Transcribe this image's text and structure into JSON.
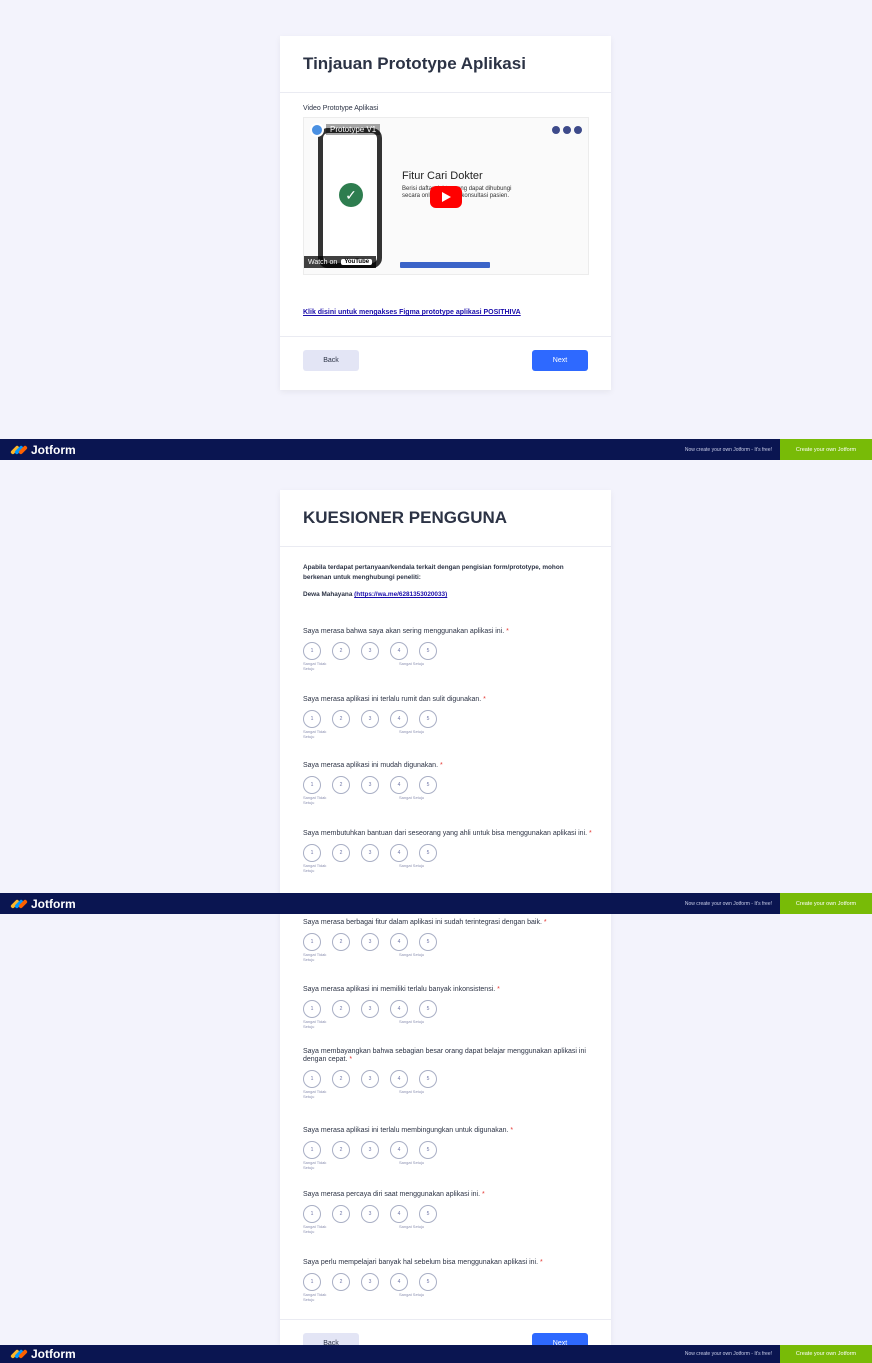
{
  "screen1": {
    "title": "Tinjauan Prototype Aplikasi",
    "video_label": "Video Prototype Aplikasi",
    "video": {
      "channel_title": "Prototype V1",
      "headline": "Fitur Cari Dokter",
      "description": "Berisi daftar dokter yang dapat dihubungi secara online & untuk konsultasi pasien.",
      "watch_on": "Watch on",
      "youtube": "YouTube"
    },
    "figma_link": "Klik disini untuk mengakses Figma prototype aplikasi POSITHIVA",
    "back": "Back",
    "next": "Next"
  },
  "banner": {
    "logo": "Jotform",
    "free_text": "Now create your own Jotform - It's free!",
    "cta": "Create your own Jotform"
  },
  "screen2": {
    "title": "KUESIONER PENGGUNA",
    "intro": "Apabila terdapat pertanyaan/kendala terkait dengan pengisian form/prototype, mohon berkenan untuk menghubungi peneliti:",
    "contact_name": "Dewa Mahayana",
    "contact_link": "(https://wa.me/6281353020033)",
    "questions": [
      "Saya merasa bahwa saya akan sering menggunakan aplikasi ini.",
      "Saya merasa aplikasi ini terlalu rumit dan sulit digunakan.",
      "Saya merasa aplikasi ini mudah digunakan.",
      "Saya membutuhkan bantuan dari seseorang yang ahli untuk bisa menggunakan aplikasi ini."
    ]
  },
  "screen3": {
    "questions": [
      "Saya merasa berbagai fitur dalam aplikasi ini sudah terintegrasi dengan baik.",
      "Saya merasa aplikasi ini memiliki terlalu banyak inkonsistensi.",
      "Saya membayangkan bahwa sebagian besar orang dapat belajar menggunakan aplikasi ini dengan cepat.",
      "Saya merasa aplikasi ini terlalu membingungkan untuk digunakan.",
      "Saya merasa percaya diri saat menggunakan aplikasi ini.",
      "Saya perlu mempelajari banyak hal sebelum bisa menggunakan aplikasi ini."
    ],
    "back": "Back",
    "next": "Next"
  },
  "scale": {
    "options": [
      "1",
      "2",
      "3",
      "4",
      "5"
    ],
    "low_label": "Sangat Tidak Setuju",
    "high_label": "Sangat Setuju"
  },
  "required_mark": "*",
  "colors": {
    "background": "#f3f3fc",
    "banner": "#0a1551",
    "cta": "#78bb07",
    "next_button": "#2e69ff",
    "back_button": "#e3e5f5",
    "required": "#e53935"
  }
}
